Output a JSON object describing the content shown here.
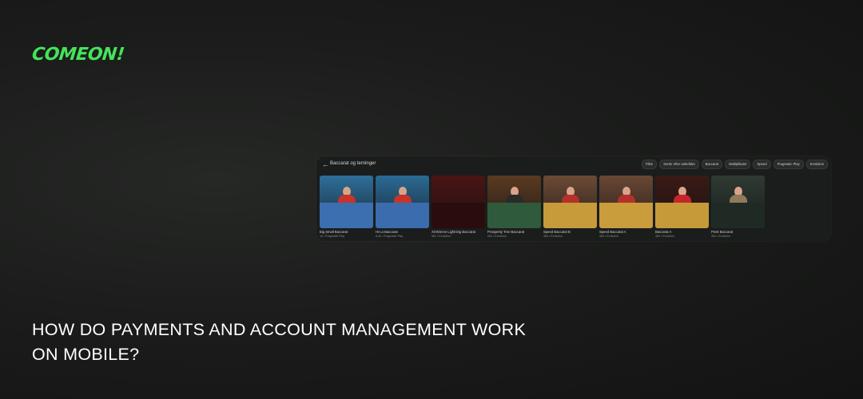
{
  "brand": {
    "logo_text": "COMEON!",
    "color": "#45e35a"
  },
  "headline": "HOW DO PAYMENTS AND ACCOUNT MANAGEMENT WORK ON MOBILE?",
  "panel": {
    "title": "Baccarat og terninger",
    "filters": [
      "Filtre",
      "Sorter efter anbefalet",
      "Baccarat",
      "Multiplikator",
      "Speed",
      "Pragmatic Play",
      "Evolution"
    ],
    "games": [
      {
        "name": "Big Small Baccarat",
        "provider": "1k • Pragmatic Play",
        "bg": "#2e6f9a",
        "table": "#3b6fb0",
        "dress": "#c8332b",
        "dealer": true
      },
      {
        "name": "Hi-Lo Baccarat",
        "provider": "8.4k • Pragmatic Play",
        "bg": "#2b6a95",
        "table": "#3a6cae",
        "dress": "#c8332b",
        "dealer": true
      },
      {
        "name": "XXXtreme Lightning Baccarat",
        "provider": "981 • Evolution",
        "bg": "#4a1414",
        "table": "#2a0c0c",
        "dress": "#7a1f1a",
        "dealer": false
      },
      {
        "name": "Prosperity Tree Baccarat",
        "provider": "994 • Evolution",
        "bg": "#5a3a22",
        "table": "#2f5a3b",
        "dress": "#2a2a2a",
        "dealer": true
      },
      {
        "name": "Speed Baccarat B",
        "provider": "384 • Evolution",
        "bg": "#6b4a35",
        "table": "#c79a3a",
        "dress": "#b5302b",
        "dealer": true
      },
      {
        "name": "Speed Baccarat A",
        "provider": "384 • Evolution",
        "bg": "#6a4734",
        "table": "#c99c3c",
        "dress": "#b5302b",
        "dealer": true
      },
      {
        "name": "Baccarat A",
        "provider": "384 • Evolution",
        "bg": "#3a1a14",
        "table": "#c69a38",
        "dress": "#c4262b",
        "dealer": true
      },
      {
        "name": "Peek Baccarat",
        "provider": "384 • Evolution",
        "bg": "#2f3a33",
        "table": "#1f2a25",
        "dress": "#8f7a5a",
        "dealer": true
      }
    ]
  }
}
